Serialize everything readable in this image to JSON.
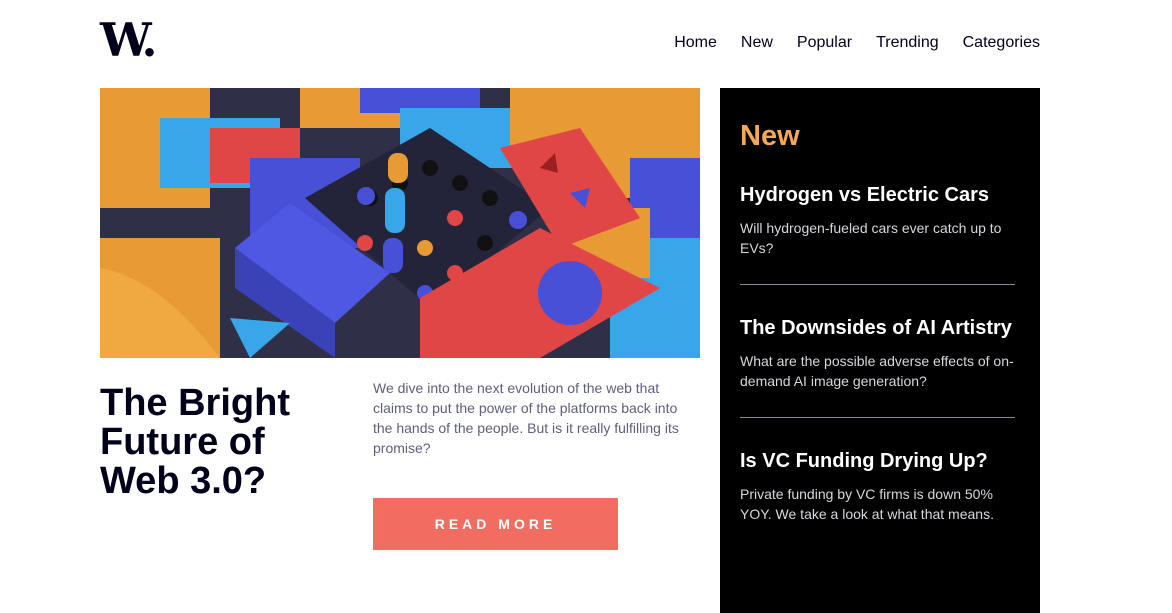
{
  "logo": {
    "text": "W."
  },
  "nav": [
    "Home",
    "New",
    "Popular",
    "Trending",
    "Categories"
  ],
  "hero": {
    "title": "The Bright Future of Web 3.0?",
    "description": "We dive into the next evolution of the web that claims to put the power of the platforms back into the hands of the people. But is it really fulfilling its promise?",
    "button_label": "READ MORE"
  },
  "sidebar": {
    "title": "New",
    "items": [
      {
        "title": "Hydrogen vs Electric Cars",
        "text": "Will hydrogen-fueled cars ever catch up to EVs?"
      },
      {
        "title": "The Downsides of AI Artistry",
        "text": "What are the possible adverse effects of on-demand AI image generation?"
      },
      {
        "title": "Is VC Funding Drying Up?",
        "text": "Private funding by VC firms is down 50% YOY. We take a look at what that means."
      }
    ]
  },
  "colors": {
    "dark_navy": "#00001a",
    "soft_orange": "#f5a859",
    "soft_red": "#f15e50",
    "grayish_blue": "#5d5f79",
    "off_white": "#fffdfa"
  }
}
